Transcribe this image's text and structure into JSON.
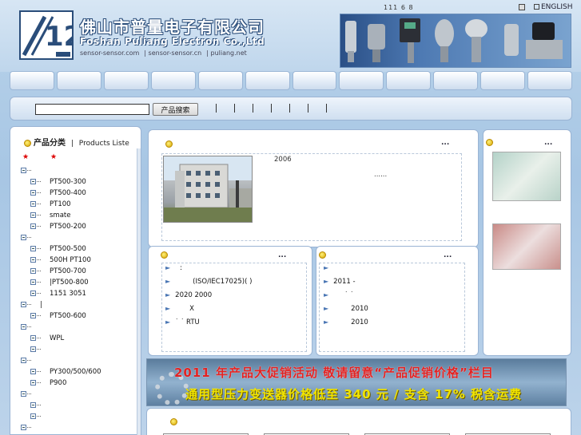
{
  "header": {
    "company_cn": "佛山市普量电子有限公司",
    "company_en": "Foshan Puliang Electron Co.,Ltd",
    "domains": [
      "sensor-sensor.com",
      "sensor-sensor.cn",
      "puliang.net"
    ],
    "top_number": "111 6 8",
    "english_label": "ENGLISH",
    "logo_text": "12"
  },
  "nav": {
    "items": [
      "",
      "",
      "",
      "",
      "",
      "",
      "",
      "",
      "",
      "",
      "",
      ""
    ]
  },
  "search": {
    "placeholder": "",
    "button_label": "产品搜索"
  },
  "sidebar": {
    "title_cn": "产品分类",
    "title_sep": "|",
    "title_en": "Products Liste",
    "stars": [
      "★",
      "★"
    ],
    "tree": [
      {
        "label": "",
        "level": 0
      },
      {
        "label": "PT500-300",
        "level": 1
      },
      {
        "label": "PT500-400",
        "level": 1
      },
      {
        "label": "PT100",
        "level": 1
      },
      {
        "label": "smate",
        "level": 1
      },
      {
        "label": "PT500-200",
        "level": 1
      },
      {
        "label": "",
        "level": 0
      },
      {
        "label": "PT500-500",
        "level": 1
      },
      {
        "label": "500H PT100",
        "level": 1
      },
      {
        "label": "PT500-700",
        "level": 1
      },
      {
        "label": "|PT500-800",
        "level": 1
      },
      {
        "label": "1151 3051",
        "level": 1
      },
      {
        "label": "|",
        "level": 0
      },
      {
        "label": "PT500-600",
        "level": 1
      },
      {
        "label": "",
        "level": 0
      },
      {
        "label": "WPL",
        "level": 1
      },
      {
        "label": "",
        "level": 1
      },
      {
        "label": "",
        "level": 0
      },
      {
        "label": "PY300/500/600",
        "level": 1
      },
      {
        "label": "P900",
        "level": 1
      },
      {
        "label": "",
        "level": 0
      },
      {
        "label": "",
        "level": 1
      },
      {
        "label": "",
        "level": 1
      },
      {
        "label": "",
        "level": 0
      }
    ]
  },
  "about": {
    "more": "...",
    "year": "2006",
    "ellipsis": "......"
  },
  "news_left": {
    "more": "...",
    "items": [
      ":",
      "(ISO/IEC17025)( )",
      "2020          2000",
      "X",
      "˙ ˙ RTU"
    ]
  },
  "news_right": {
    "more": "...",
    "items": [
      "",
      "2011         -",
      "˙ ˙",
      "2010",
      "2010"
    ]
  },
  "certs": {
    "more": "..."
  },
  "promo": {
    "line1": "2011 年产品大促销活动    敬请留意“产品促销价格”栏目",
    "line2": "通用型压力变送器价格低至 340 元 / 支含 17% 税含运费"
  },
  "bottom": {
    "bullet": ""
  }
}
